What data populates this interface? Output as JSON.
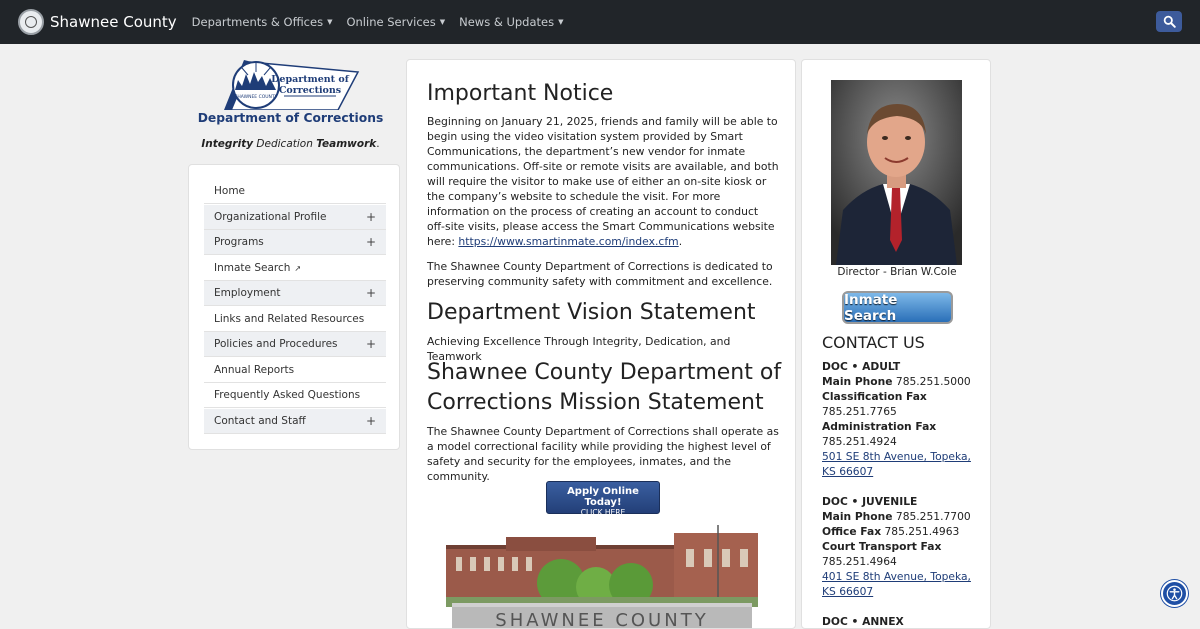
{
  "nav": {
    "brand": "Shawnee County",
    "items": [
      "Departments & Offices",
      "Online Services",
      "News & Updates"
    ]
  },
  "left": {
    "logo_line1": "Department of",
    "logo_line2": "Corrections",
    "seal_text": "SHAWNEE COUNTY",
    "dept_title": "Department of Corrections",
    "motto": {
      "w1": "Integrity",
      "w2": "Dedication",
      "w3": "Teamwork",
      "end": "."
    },
    "menu": [
      {
        "label": "Home",
        "plus": ""
      },
      {
        "label": "Organizational Profile",
        "plus": "+"
      },
      {
        "label": "Programs",
        "plus": "+"
      },
      {
        "label": "Inmate Search",
        "plus": ""
      },
      {
        "label": "Employment",
        "plus": "+"
      },
      {
        "label": "Links and Related Resources",
        "plus": ""
      },
      {
        "label": "Policies and Procedures",
        "plus": "+"
      },
      {
        "label": "Annual Reports",
        "plus": ""
      },
      {
        "label": "Frequently Asked Questions",
        "plus": ""
      },
      {
        "label": "Contact and Staff",
        "plus": "+"
      }
    ]
  },
  "main": {
    "notice_title": "Important Notice",
    "notice_body": "Beginning on January 21, 2025, friends and family will be able to begin using the video visitation system provided by Smart Communications, the department’s new vendor for inmate communications. Off-site or remote visits are available, and both will require the visitor to make use of either an on-site kiosk or the company’s website to schedule the visit. For more information on the process of creating an account to conduct off-site visits, please access the Smart Communications website here: ",
    "notice_link": "https://www.smartinmate.com/index.cfm",
    "notice_end": ".",
    "dedicated": "The Shawnee County Department of Corrections is dedicated to preserving community safety with commitment and excellence.",
    "vision_title": "Department Vision Statement",
    "vision_body": "Achieving Excellence Through Integrity, Dedication, and Teamwork",
    "mission_title_1": "Shawnee County Department of",
    "mission_title_2": "Corrections Mission Statement",
    "mission_body": "The Shawnee County Department of Corrections shall operate as a model correctional facility while providing the highest level of safety and security for the employees, inmates, and the community.",
    "apply_line1": "Apply Online Today!",
    "apply_line2": "CLICK HERE",
    "sign_text": "SHAWNEE COUNTY"
  },
  "right": {
    "director_caption": "Director - Brian W.Cole",
    "inmate_search_label": "Inmate Search",
    "contact_title": "CONTACT US",
    "adult": {
      "heading": "DOC • ADULT",
      "main_phone_label": "Main Phone",
      "main_phone": "785.251.5000",
      "class_fax_label": "Classification Fax",
      "class_fax": "785.251.7765",
      "admin_fax_label": "Administration Fax",
      "admin_fax": "785.251.4924",
      "address": "501 SE 8th Avenue, Topeka, KS 66607"
    },
    "juvenile": {
      "heading": "DOC • JUVENILE",
      "main_phone_label": "Main Phone",
      "main_phone": "785.251.7700",
      "office_fax_label": "Office Fax",
      "office_fax": "785.251.4963",
      "court_fax_label": "Court Transport Fax",
      "court_fax": "785.251.4964",
      "address": "401 SE 8th Avenue, Topeka, KS 66607"
    },
    "annex_heading": "DOC • ANNEX"
  },
  "colors": {
    "navbar": "#212529",
    "accent": "#1f3d78",
    "search_button": "#3d5b9b",
    "accessibility": "#1f4fa5"
  },
  "icons": [
    "search-icon",
    "external-link-icon",
    "accessibility-icon",
    "county-seal-icon"
  ]
}
